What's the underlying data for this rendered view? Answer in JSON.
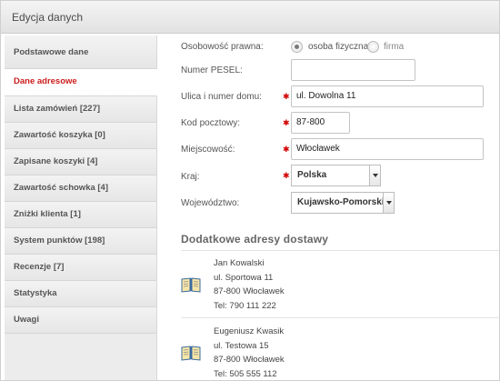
{
  "title": "Edycja danych",
  "sidebar": {
    "items": [
      {
        "label": "Podstawowe dane"
      },
      {
        "label": "Dane adresowe"
      },
      {
        "label": "Lista zamówień [227]"
      },
      {
        "label": "Zawartość koszyka [0]"
      },
      {
        "label": "Zapisane koszyki [4]"
      },
      {
        "label": "Zawartość schowka [4]"
      },
      {
        "label": "Zniżki klienta [1]"
      },
      {
        "label": "System punktów [198]"
      },
      {
        "label": "Recenzje [7]"
      },
      {
        "label": "Statystyka"
      },
      {
        "label": "Uwagi"
      }
    ],
    "active_index": 1
  },
  "form": {
    "legal_form": {
      "label": "Osobowość prawna:",
      "option_person": "osoba fizyczna",
      "option_company": "firma",
      "selected": "osoba fizyczna"
    },
    "pesel": {
      "label": "Numer PESEL:",
      "value": ""
    },
    "street": {
      "label": "Ulica i numer domu:",
      "value": "ul. Dowolna 11",
      "required": true
    },
    "postal": {
      "label": "Kod pocztowy:",
      "value": "87-800",
      "required": true
    },
    "city": {
      "label": "Miejscowość:",
      "value": "Włocławek",
      "required": true
    },
    "country": {
      "label": "Kraj:",
      "value": "Polska",
      "required": true
    },
    "voivodeship": {
      "label": "Województwo:",
      "value": "Kujawsko-Pomorskie"
    }
  },
  "additional": {
    "title": "Dodatkowe adresy dostawy",
    "addresses": [
      {
        "name": "Jan Kowalski",
        "street": "ul. Sportowa 11",
        "city": "87-800 Włocławek",
        "phone": "Tel: 790 111 222"
      },
      {
        "name": "Eugeniusz Kwasik",
        "street": "ul. Testowa 15",
        "city": "87-800 Włocławek",
        "phone": "Tel: 505 555 112"
      }
    ]
  },
  "colors": {
    "accent": "#cc1c1c",
    "required": "#d10000"
  },
  "icons": {
    "address_entry": "book-icon",
    "dropdown": "chevron-down-icon"
  }
}
